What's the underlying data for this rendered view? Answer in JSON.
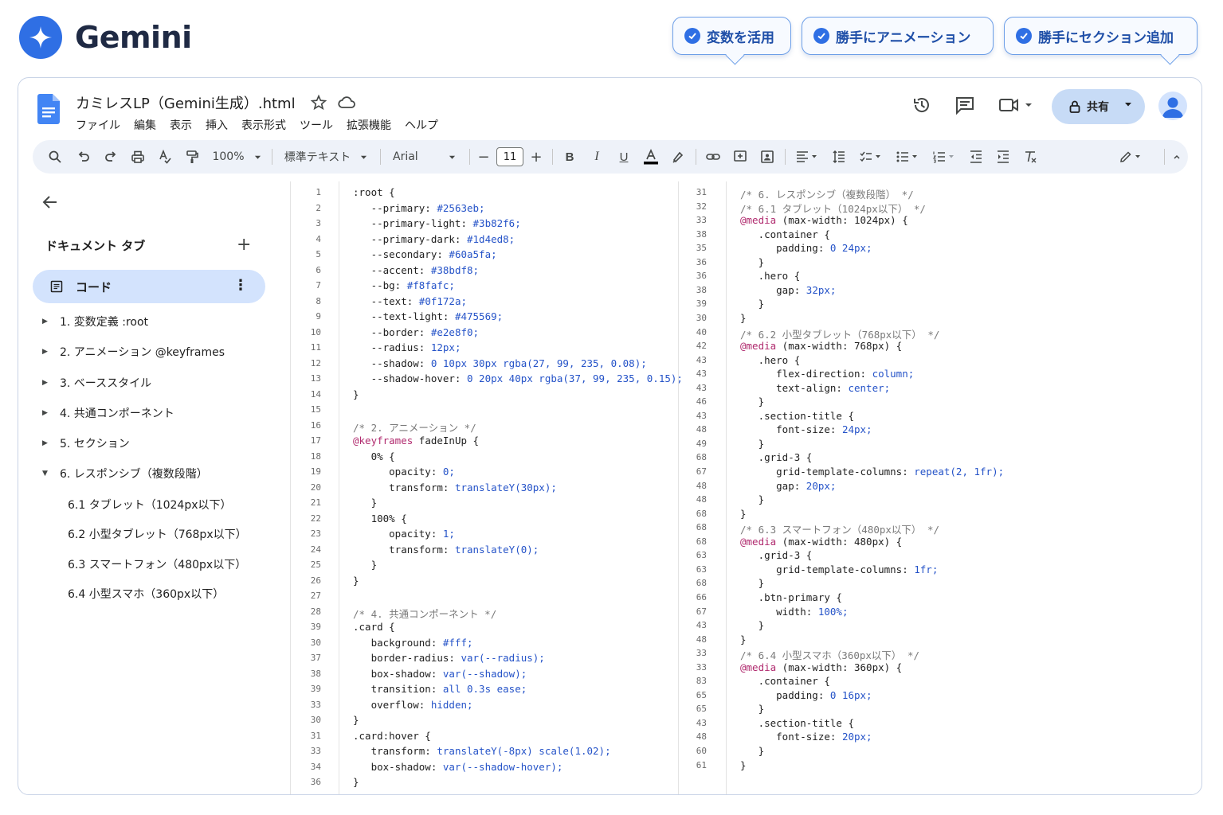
{
  "brand": {
    "name": "Gemini"
  },
  "callouts": [
    "変数を活用",
    "勝手にアニメーション",
    "勝手にセクション追加"
  ],
  "doc": {
    "title": "カミレスLP（Gemini生成）.html",
    "menu": [
      "ファイル",
      "編集",
      "表示",
      "挿入",
      "表示形式",
      "ツール",
      "拡張機能",
      "ヘルプ"
    ],
    "share_label": "共有"
  },
  "toolbar": {
    "zoom": "100%",
    "style": "標準テキスト",
    "font": "Arial",
    "font_size": "11"
  },
  "sidebar": {
    "tabs_header": "ドキュメント タブ",
    "active_tab": "コード",
    "outline": [
      "1. 変数定義 :root",
      "2. アニメーション @keyframes",
      "3. ベーススタイル",
      "4. 共通コンポーネント",
      "5. セクション",
      "6. レスポンシブ（複数段階）"
    ],
    "sub_outline": [
      "6.1 タブレット（1024px以下）",
      "6.2 小型タブレット（768px以下）",
      "6.3 スマートフォン（480px以下）",
      "6.4 小型スマホ（360px以下）"
    ]
  },
  "code_left": {
    "line_numbers": [
      "1",
      "2",
      "3",
      "4",
      "5",
      "6",
      "7",
      "8",
      "9",
      "10",
      "11",
      "12",
      "13",
      "14",
      "15",
      "16",
      "17",
      "18",
      "19",
      "20",
      "21",
      "22",
      "23",
      "24",
      "25",
      "26",
      "27",
      "28",
      "39",
      "30",
      "37",
      "38",
      "39",
      "33",
      "30",
      "31",
      "33",
      "34",
      "36"
    ],
    "lines": [
      ":root {",
      "   --primary: #2563eb;",
      "   --primary-light: #3b82f6;",
      "   --primary-dark: #1d4ed8;",
      "   --secondary: #60a5fa;",
      "   --accent: #38bdf8;",
      "   --bg: #f8fafc;",
      "   --text: #0f172a;",
      "   --text-light: #475569;",
      "   --border: #e2e8f0;",
      "   --radius: 12px;",
      "   --shadow: 0 10px 30px rgba(27, 99, 235, 0.08);",
      "   --shadow-hover: 0 20px 40px rgba(37, 99, 235, 0.15);",
      "}",
      "",
      "/* 2. アニメーション */",
      "@keyframes fadeInUp {",
      "   0% {",
      "      opacity: 0;",
      "      transform: translateY(30px);",
      "   }",
      "   100% {",
      "      opacity: 1;",
      "      transform: translateY(0);",
      "   }",
      "}",
      "",
      "/* 4. 共通コンポーネント */",
      ".card {",
      "   background: #fff;",
      "   border-radius: var(--radius);",
      "   box-shadow: var(--shadow);",
      "   transition: all 0.3s ease;",
      "   overflow: hidden;",
      "}",
      ".card:hover {",
      "   transform: translateY(-8px) scale(1.02);",
      "   box-shadow: var(--shadow-hover);",
      "}"
    ]
  },
  "code_right": {
    "line_numbers": [
      "31",
      "32",
      "33",
      "38",
      "35",
      "36",
      "36",
      "38",
      "39",
      "30",
      "40",
      "42",
      "43",
      "43",
      "43",
      "46",
      "43",
      "48",
      "49",
      "68",
      "67",
      "48",
      "48",
      "68",
      "68",
      "68",
      "63",
      "63",
      "68",
      "66",
      "67",
      "43",
      "48",
      "33",
      "33",
      "83",
      "65",
      "65",
      "43",
      "48",
      "60",
      "61"
    ],
    "lines": [
      "/* 6. レスポンシブ（複数段階） */",
      "/* 6.1 タブレット（1024px以下） */",
      "@media (max-width: 1024px) {",
      "   .container {",
      "      padding: 0 24px;",
      "   }",
      "   .hero {",
      "      gap: 32px;",
      "   }",
      "}",
      "/* 6.2 小型タブレット（768px以下） */",
      "@media (max-width: 768px) {",
      "   .hero {",
      "      flex-direction: column;",
      "      text-align: center;",
      "   }",
      "   .section-title {",
      "      font-size: 24px;",
      "   }",
      "   .grid-3 {",
      "      grid-template-columns: repeat(2, 1fr);",
      "      gap: 20px;",
      "   }",
      "}",
      "/* 6.3 スマートフォン（480px以下） */",
      "@media (max-width: 480px) {",
      "   .grid-3 {",
      "      grid-template-columns: 1fr;",
      "   }",
      "   .btn-primary {",
      "      width: 100%;",
      "   }",
      "}",
      "/* 6.4 小型スマホ（360px以下） */",
      "@media (max-width: 360px) {",
      "   .container {",
      "      padding: 0 16px;",
      "   }",
      "   .section-title {",
      "      font-size: 20px;",
      "   }",
      "}"
    ]
  },
  "colors": {
    "accent": "#2f6fe4",
    "code_keyword": "#2553c8",
    "code_comment": "#7a7a7a",
    "code_at_rule": "#b02a6e",
    "active_tab_bg": "#d3e3fd"
  }
}
